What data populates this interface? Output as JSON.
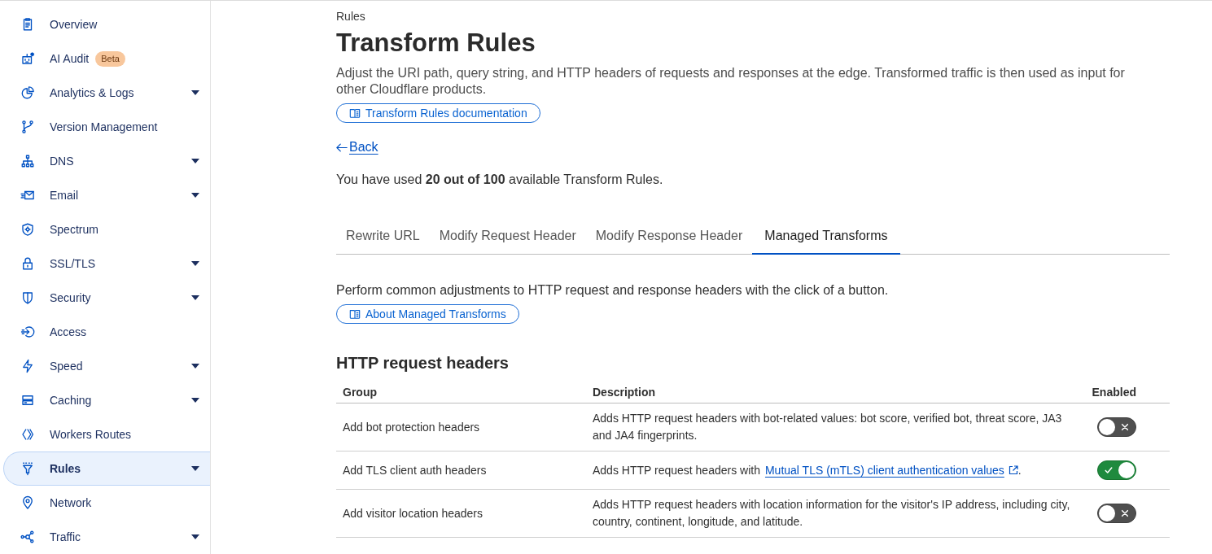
{
  "sidebar": {
    "items": [
      {
        "label": "Overview",
        "expandable": false,
        "selected": false
      },
      {
        "label": "AI Audit",
        "badge": "Beta",
        "expandable": false,
        "selected": false
      },
      {
        "label": "Analytics & Logs",
        "expandable": true,
        "selected": false
      },
      {
        "label": "Version Management",
        "expandable": false,
        "selected": false
      },
      {
        "label": "DNS",
        "expandable": true,
        "selected": false
      },
      {
        "label": "Email",
        "expandable": true,
        "selected": false
      },
      {
        "label": "Spectrum",
        "expandable": false,
        "selected": false
      },
      {
        "label": "SSL/TLS",
        "expandable": true,
        "selected": false
      },
      {
        "label": "Security",
        "expandable": true,
        "selected": false
      },
      {
        "label": "Access",
        "expandable": false,
        "selected": false
      },
      {
        "label": "Speed",
        "expandable": true,
        "selected": false
      },
      {
        "label": "Caching",
        "expandable": true,
        "selected": false
      },
      {
        "label": "Workers Routes",
        "expandable": false,
        "selected": false
      },
      {
        "label": "Rules",
        "expandable": true,
        "selected": true
      },
      {
        "label": "Network",
        "expandable": false,
        "selected": false
      },
      {
        "label": "Traffic",
        "expandable": true,
        "selected": false
      }
    ]
  },
  "header": {
    "breadcrumb": "Rules",
    "title": "Transform Rules",
    "description": "Adjust the URI path, query string, and HTTP headers of requests and responses at the edge. Transformed traffic is then used as input for other Cloudflare products.",
    "doc_button": "Transform Rules documentation",
    "back_link": "Back",
    "usage": "You have used **20 out of 100** available Transform Rules."
  },
  "tabs": [
    {
      "label": "Rewrite URL",
      "selected": false
    },
    {
      "label": "Modify Request Header",
      "selected": false
    },
    {
      "label": "Modify Response Header",
      "selected": false
    },
    {
      "label": "Managed Transforms",
      "selected": true
    }
  ],
  "managed": {
    "intro": "Perform common adjustments to HTTP request and response headers with the click of a button.",
    "about_button": "About Managed Transforms"
  },
  "request_headers": {
    "heading": "HTTP request headers",
    "columns": [
      "Group",
      "Description",
      "Enabled"
    ],
    "rows": [
      {
        "group": "Add bot protection headers",
        "description": "Adds HTTP request headers with bot-related values: bot score, verified bot, threat score, JA3 and JA4 fingerprints.",
        "enabled": false
      },
      {
        "group": "Add TLS client auth headers",
        "description": "Adds HTTP request headers with",
        "link": "Mutual TLS (mTLS) client authentication values",
        "description_end": ".",
        "enabled": true
      },
      {
        "group": "Add visitor location headers",
        "description": "Adds HTTP request headers with location information for the visitor's IP address, including city, country, continent, longitude, and latitude.",
        "enabled": false
      }
    ]
  }
}
